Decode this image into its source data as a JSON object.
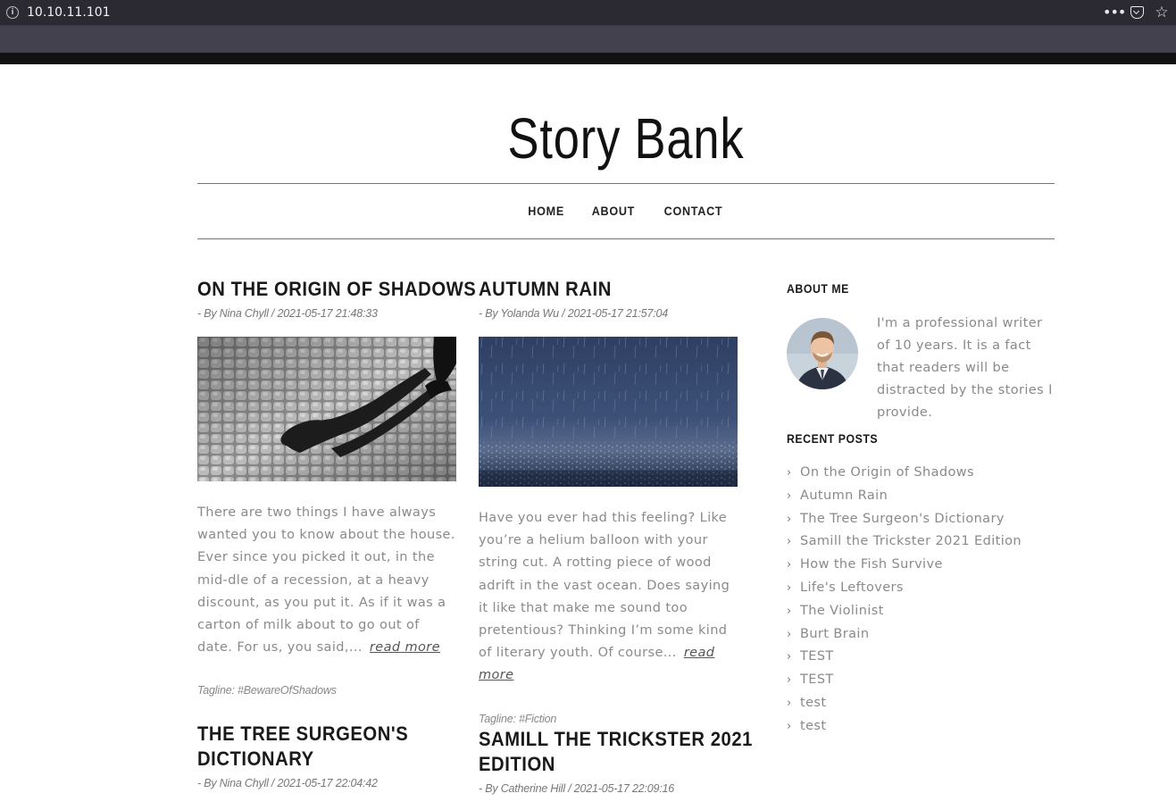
{
  "browser": {
    "url": "10.10.11.101",
    "info_icon": "info-icon",
    "more_icon": "ellipsis-icon",
    "pocket_icon": "pocket-icon",
    "star_icon": "star-icon"
  },
  "site": {
    "title": "Story Bank"
  },
  "nav": {
    "items": [
      "HOME",
      "ABOUT",
      "CONTACT"
    ]
  },
  "posts": [
    {
      "title": "ON THE ORIGIN OF SHADOWS",
      "meta": "- By Nina Chyll / 2021-05-17 21:48:33",
      "excerpt": "There are two things I have always wanted you to know about the house. Ever since you picked it out, in the mid-dle of a recession, at a heavy discount, as you put it. As if it was a carton of milk about to go out of date. For us, you said,...",
      "read_more": "read more",
      "tagline": "Tagline: #BewareOfShadows"
    },
    {
      "title": "AUTUMN RAIN",
      "meta": "- By Yolanda Wu / 2021-05-17 21:57:04",
      "excerpt": "Have you ever had this feeling? Like you’re a helium balloon with your string cut. A rotting piece of wood adrift in the vast ocean. Does saying it like that make me sound too pretentious? Thinking I’m some kind of literary youth. Of course...",
      "read_more": "read more",
      "tagline": "Tagline: #Fiction"
    },
    {
      "title_line1": "THE TREE SURGEON'S",
      "title_line2": "DICTIONARY",
      "meta": "- By Nina Chyll / 2021-05-17 22:04:42"
    },
    {
      "title_line1": "SAMILL THE TRICKSTER 2021",
      "title_line2": "EDITION",
      "meta": "- By Catherine Hill / 2021-05-17 22:09:16"
    }
  ],
  "sidebar": {
    "about_heading": "ABOUT ME",
    "about_text": "I'm a professional writer of 10 years. It is a fact that readers will be distracted by the stories I provide.",
    "recent_heading": "RECENT POSTS",
    "recent_posts": [
      "On the Origin of Shadows",
      "Autumn Rain",
      "The Tree Surgeon's Dictionary",
      "Samill the Trickster 2021 Edition",
      "How the Fish Survive",
      "Life's Leftovers",
      "The Violinist",
      "Burt Brain",
      "TEST",
      "TEST",
      "test",
      "test"
    ]
  }
}
